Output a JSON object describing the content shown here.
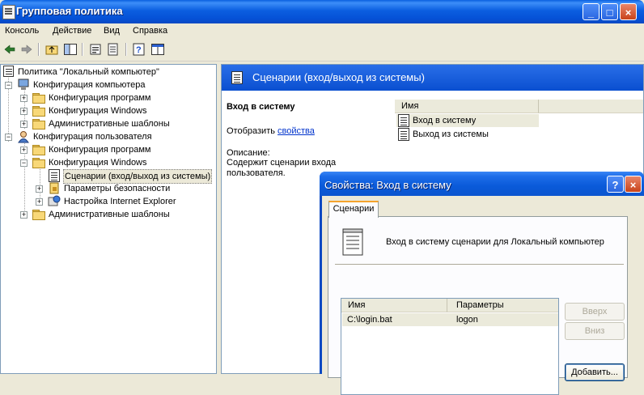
{
  "window": {
    "title": "Групповая политика",
    "buttons": {
      "minimize": "_",
      "maximize": "□",
      "close": "×"
    }
  },
  "menu": [
    "Консоль",
    "Действие",
    "Вид",
    "Справка"
  ],
  "tree": {
    "root": "Политика \"Локальный компьютер\"",
    "computer_config": "Конфигурация компьютера",
    "cc_programs": "Конфигурация программ",
    "cc_windows": "Конфигурация Windows",
    "cc_admin": "Административные шаблоны",
    "user_config": "Конфигурация пользователя",
    "uc_programs": "Конфигурация программ",
    "uc_windows": "Конфигурация Windows",
    "uc_scripts": "Сценарии (вход/выход из системы)",
    "uc_security": "Параметры безопасности",
    "uc_ie": "Настройка Internet Explorer",
    "uc_admin": "Административные шаблоны"
  },
  "details": {
    "header": "Сценарии (вход/выход из системы)",
    "heading": "Вход в систему",
    "display_prefix": "Отобразить",
    "display_link": "свойства",
    "description_label": "Описание:",
    "description_text": "Содержит сценарии входа пользователя.",
    "list_header": "Имя",
    "items": [
      "Вход в систему",
      "Выход из системы"
    ]
  },
  "dialog": {
    "title": "Свойства: Вход в систему",
    "help": "?",
    "close": "×",
    "tab": "Сценарии",
    "caption": "Вход в систему сценарии для Локальный компьютер",
    "columns": [
      "Имя",
      "Параметры"
    ],
    "rows": [
      {
        "name": "C:\\login.bat",
        "params": "logon"
      }
    ],
    "buttons": {
      "up": "Вверх",
      "down": "Вниз",
      "add": "Добавить..."
    }
  }
}
